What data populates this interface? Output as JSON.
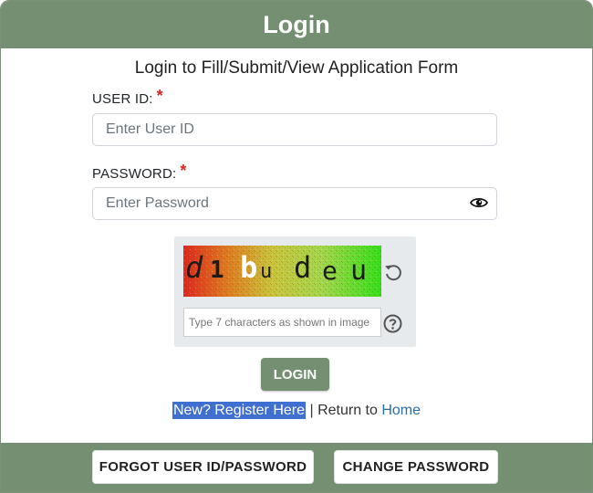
{
  "header": {
    "title": "Login"
  },
  "form": {
    "subtitle": "Login to Fill/Submit/View Application Form",
    "user_id": {
      "label": "USER ID:",
      "required_mark": "*",
      "placeholder": "Enter User ID",
      "value": ""
    },
    "password": {
      "label": "PASSWORD:",
      "required_mark": "*",
      "placeholder": "Enter Password",
      "value": ""
    },
    "captcha": {
      "image_text": [
        "d",
        "1",
        "b",
        "u",
        "d",
        "e",
        "u"
      ],
      "input_placeholder": "Type 7 characters as shown in image",
      "input_value": ""
    },
    "login_button": "LOGIN"
  },
  "links": {
    "register": "New? Register Here",
    "separator": "|",
    "return_text": "Return to",
    "home": "Home"
  },
  "footer": {
    "forgot_button": "FORGOT USER ID/PASSWORD",
    "change_password_button": "CHANGE PASSWORD"
  },
  "colors": {
    "header_bg": "#748f71",
    "required": "#d62828",
    "register_highlight": "#3f6fd1",
    "home_link": "#2a6fa8"
  }
}
